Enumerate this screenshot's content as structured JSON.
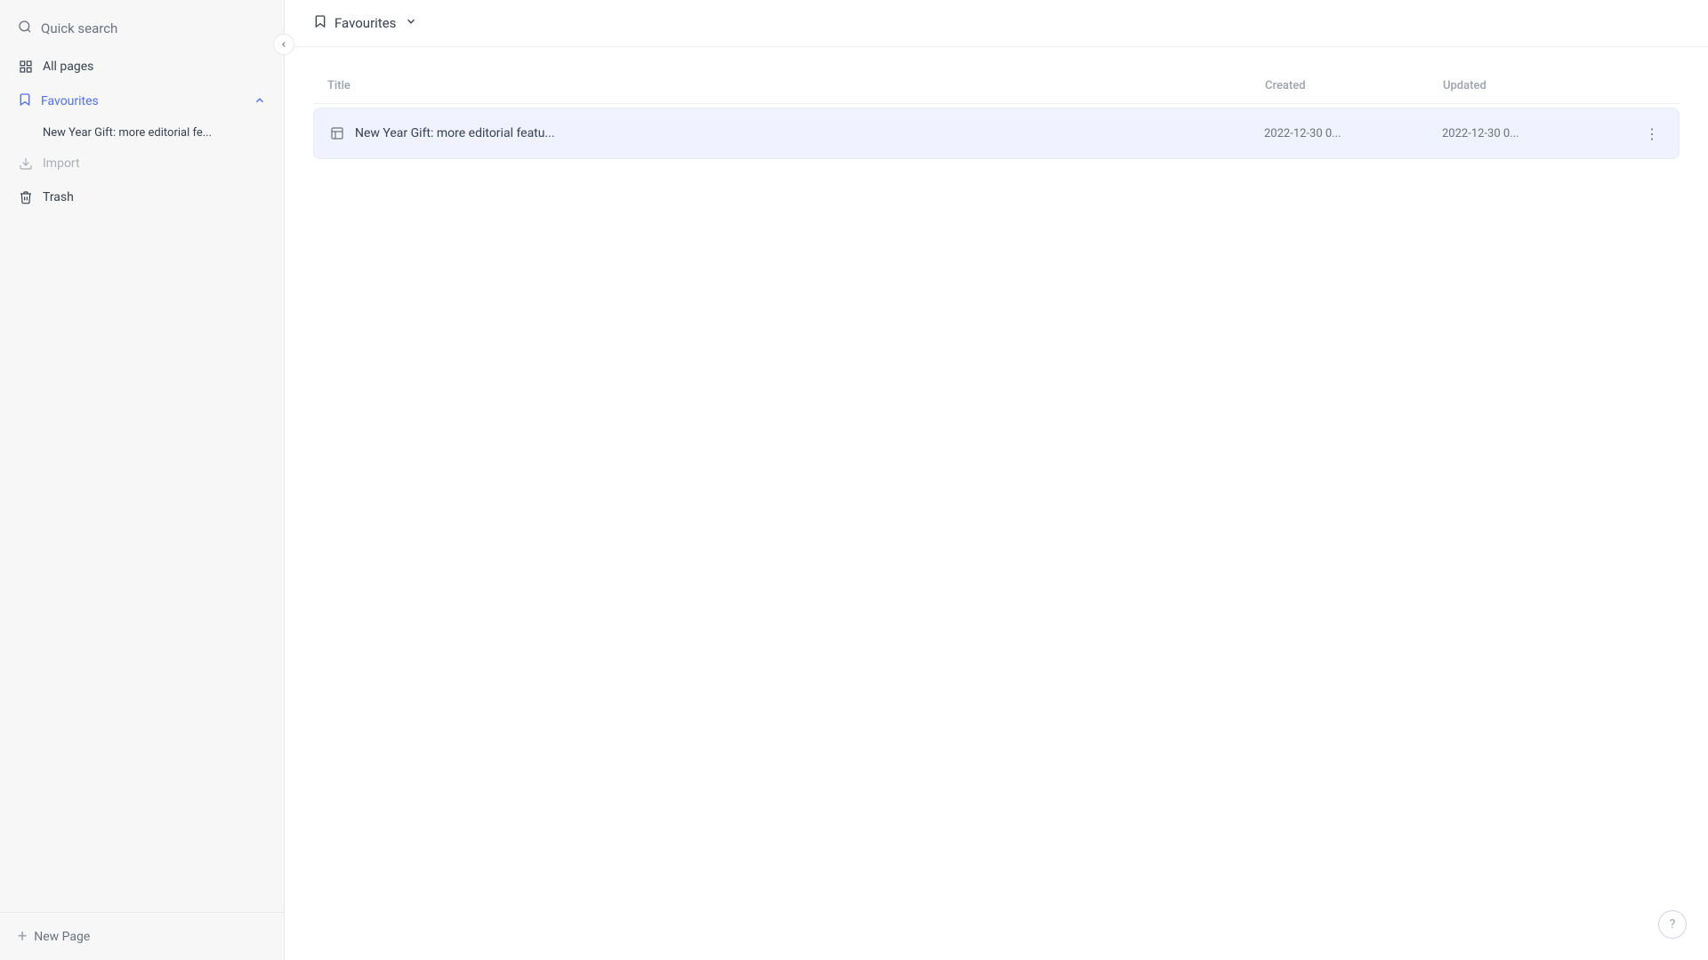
{
  "sidebar": {
    "quick_search_label": "Quick search",
    "all_pages_label": "All pages",
    "favourites_label": "Favourites",
    "favourites_sub_item": "New Year Gift: more editorial fe...",
    "import_label": "Import",
    "trash_label": "Trash",
    "new_page_label": "New Page"
  },
  "header": {
    "title": "Favourites",
    "title_icon": "bookmark"
  },
  "table": {
    "columns": [
      "Title",
      "Created",
      "Updated"
    ],
    "rows": [
      {
        "title": "New Year Gift: more editorial featu...",
        "created": "2022-12-30 0...",
        "updated": "2022-12-30 0..."
      }
    ]
  },
  "icons": {
    "search": "🔍",
    "bookmark": "🔖",
    "collapse": "‹",
    "chevron_up": "^",
    "chevron_down": "v",
    "help": "?",
    "more": "⋮"
  }
}
